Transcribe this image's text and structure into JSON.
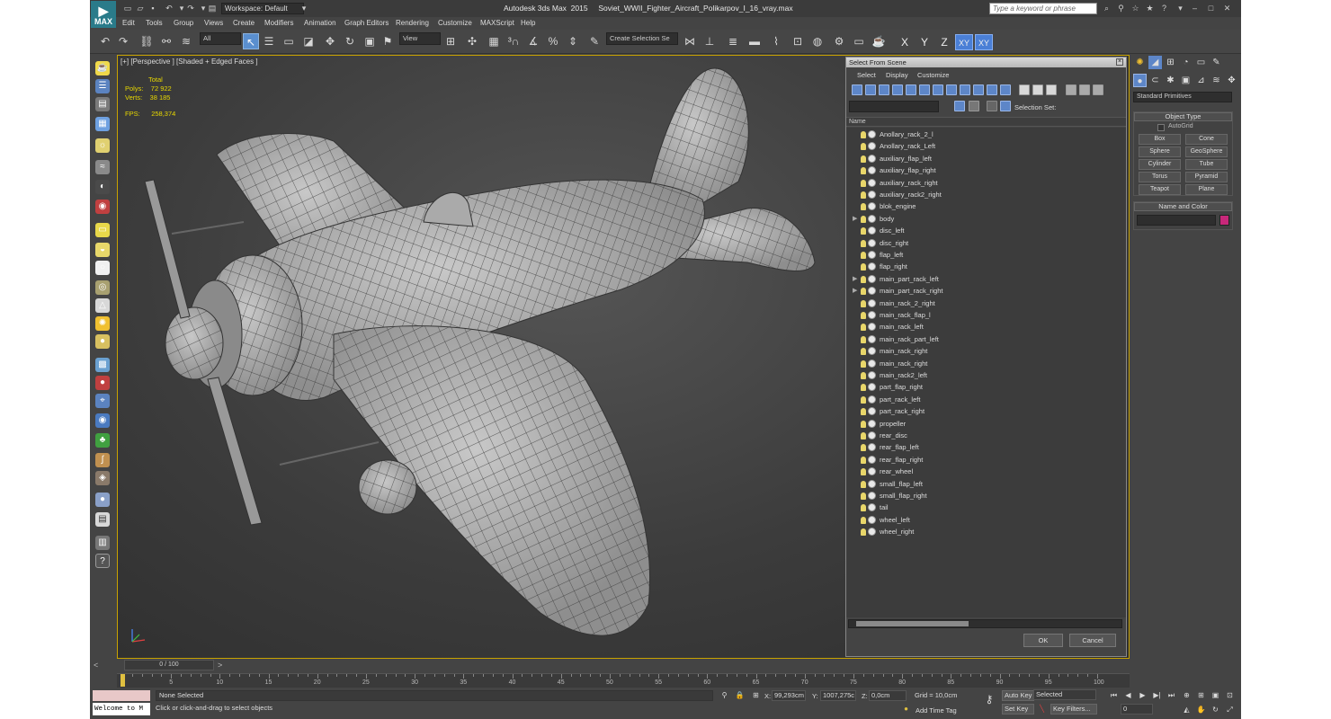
{
  "title_bar": {
    "logo_label": "MAX",
    "workspace": "Workspace: Default",
    "title": "Autodesk 3ds Max  2015     Soviet_WWII_Fighter_Aircraft_Polikarpov_I_16_vray.max",
    "search_placeholder": "Type a keyword or phrase"
  },
  "menu": [
    "Edit",
    "Tools",
    "Group",
    "Views",
    "Create",
    "Modifiers",
    "Animation",
    "Graph Editors",
    "Rendering",
    "Customize",
    "MAXScript",
    "Help"
  ],
  "toolbar": {
    "filter": "All",
    "ref_coord": "View",
    "selection_set": "Create Selection Se",
    "axes": [
      "X",
      "Y",
      "Z",
      "XY",
      "XY"
    ]
  },
  "viewport": {
    "label": "[+] [Perspective ] [Shaded + Edged Faces ]",
    "stats": {
      "header": "Total",
      "polys_label": "Polys:",
      "polys": "72 922",
      "verts_label": "Verts:",
      "verts": "38 185",
      "fps_label": "FPS:",
      "fps": "258,374"
    }
  },
  "scene_explorer": {
    "title": "Select From Scene",
    "menu": [
      "Select",
      "Display",
      "Customize"
    ],
    "selection_set_label": "Selection Set:",
    "column": "Name",
    "items": [
      {
        "name": "Anollary_rack_2_l",
        "expandable": false
      },
      {
        "name": "Anollary_rack_Left",
        "expandable": false
      },
      {
        "name": "auxiliary_flap_left",
        "expandable": false
      },
      {
        "name": "auxiliary_flap_right",
        "expandable": false
      },
      {
        "name": "auxiliary_rack_right",
        "expandable": false
      },
      {
        "name": "auxiliary_rack2_right",
        "expandable": false
      },
      {
        "name": "blok_engine",
        "expandable": false
      },
      {
        "name": "body",
        "expandable": true
      },
      {
        "name": "disc_left",
        "expandable": false
      },
      {
        "name": "disc_right",
        "expandable": false
      },
      {
        "name": "flap_left",
        "expandable": false
      },
      {
        "name": "flap_right",
        "expandable": false
      },
      {
        "name": "main_part_rack_left",
        "expandable": true
      },
      {
        "name": "main_part_rack_right",
        "expandable": true
      },
      {
        "name": "main_rack_2_right",
        "expandable": false
      },
      {
        "name": "main_rack_flap_l",
        "expandable": false
      },
      {
        "name": "main_rack_left",
        "expandable": false
      },
      {
        "name": "main_rack_part_left",
        "expandable": false
      },
      {
        "name": "main_rack_right",
        "expandable": false
      },
      {
        "name": "main_rack_right",
        "expandable": false
      },
      {
        "name": "main_rack2_left",
        "expandable": false
      },
      {
        "name": "part_flap_right",
        "expandable": false
      },
      {
        "name": "part_rack_left",
        "expandable": false
      },
      {
        "name": "part_rack_right",
        "expandable": false
      },
      {
        "name": "propeller",
        "expandable": false
      },
      {
        "name": "rear_disc",
        "expandable": false
      },
      {
        "name": "rear_flap_left",
        "expandable": false
      },
      {
        "name": "rear_flap_right",
        "expandable": false
      },
      {
        "name": "rear_wheel",
        "expandable": false
      },
      {
        "name": "small_flap_left",
        "expandable": false
      },
      {
        "name": "small_flap_right",
        "expandable": false
      },
      {
        "name": "tail",
        "expandable": false
      },
      {
        "name": "wheel_left",
        "expandable": false
      },
      {
        "name": "wheel_right",
        "expandable": false
      }
    ],
    "ok": "OK",
    "cancel": "Cancel"
  },
  "command_panel": {
    "category": "Standard Primitives",
    "object_type_title": "Object Type",
    "autogrid": "AutoGrid",
    "primitives": [
      "Box",
      "Cone",
      "Sphere",
      "GeoSphere",
      "Cylinder",
      "Tube",
      "Torus",
      "Pyramid",
      "Teapot",
      "Plane"
    ],
    "name_color_title": "Name and Color",
    "object_color": "#c8287a"
  },
  "timeline": {
    "slider": "0 / 100",
    "ticks": [
      "0",
      "5",
      "10",
      "15",
      "20",
      "25",
      "30",
      "35",
      "40",
      "45",
      "50",
      "55",
      "60",
      "65",
      "70",
      "75",
      "80",
      "85",
      "90",
      "95",
      "100"
    ]
  },
  "status": {
    "listener": "Welcome to M",
    "selection": "None Selected",
    "prompt": "Click or click-and-drag to select objects",
    "x_label": "X:",
    "x": "99,293cm",
    "y_label": "Y:",
    "y": "1007,275c",
    "z_label": "Z:",
    "z": "0,0cm",
    "grid": "Grid = 10,0cm",
    "add_time_tag": "Add Time Tag",
    "auto_key": "Auto Key",
    "set_key": "Set Key",
    "key_mode": "Selected",
    "key_filters": "Key Filters...",
    "frame": "0"
  },
  "colors": {
    "accent": "#5d86c8",
    "viewport_border": "#c8a200",
    "stats": "#e8d800"
  }
}
